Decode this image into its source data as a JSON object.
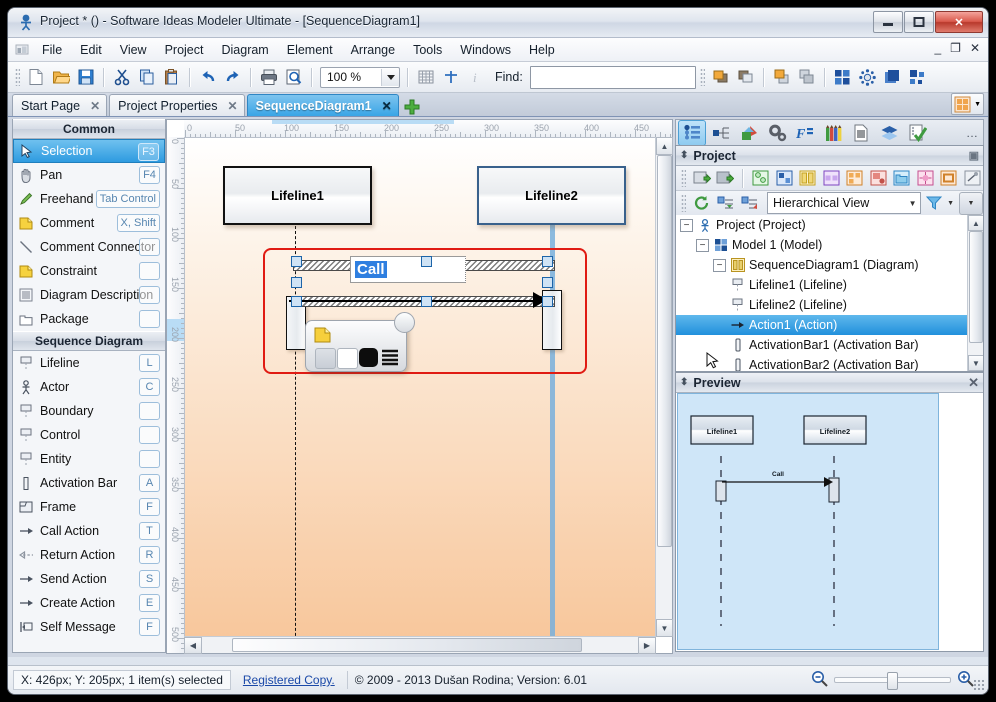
{
  "window": {
    "title": "Project *  ()  - Software Ideas Modeler Ultimate - [SequenceDiagram1]",
    "minimize": "—",
    "maximize": "▭",
    "close": "✕",
    "mdi_minimize": "_",
    "mdi_restore": "❐",
    "mdi_close": "✕"
  },
  "menu": {
    "items": [
      "File",
      "Edit",
      "View",
      "Project",
      "Diagram",
      "Element",
      "Arrange",
      "Tools",
      "Windows",
      "Help"
    ]
  },
  "toolbar": {
    "zoom_value": "100 %",
    "find_label": "Find:",
    "find_value": "",
    "find_placeholder": "",
    "buttons": [
      "new-document",
      "open-file",
      "save-file",
      "cut",
      "copy",
      "paste",
      "undo",
      "redo",
      "print",
      "print-preview",
      "grid",
      "snap",
      "info"
    ],
    "right_buttons": [
      "bring-forward",
      "send-backward",
      "bring-to-front",
      "send-to-back",
      "layout-grid",
      "layout-radial",
      "layout-stack",
      "layout-tree"
    ]
  },
  "tabs": {
    "items": [
      {
        "label": "Start Page",
        "close": "✕",
        "active": false
      },
      {
        "label": "Project Properties",
        "close": "✕",
        "active": false
      },
      {
        "label": "SequenceDiagram1",
        "close": "✕",
        "active": true
      }
    ],
    "add_label": "+"
  },
  "toolbox": {
    "groups": [
      {
        "title": "Common",
        "items": [
          {
            "label": "Selection",
            "key": "F3",
            "icon": "cursor-icon",
            "selected": true
          },
          {
            "label": "Pan",
            "key": "F4",
            "icon": "hand-icon",
            "selected": false
          },
          {
            "label": "Freehand",
            "key": "Tab Control",
            "icon": "pencil-icon",
            "selected": false
          },
          {
            "label": "Comment",
            "key": "X, Shift",
            "icon": "note-icon",
            "selected": false
          },
          {
            "label": "Comment Connector",
            "key": "",
            "icon": "line-icon",
            "selected": false
          },
          {
            "label": "Constraint",
            "key": "",
            "icon": "note-icon",
            "selected": false
          },
          {
            "label": "Diagram Description",
            "key": "",
            "icon": "lines-icon",
            "selected": false
          },
          {
            "label": "Package",
            "key": "",
            "icon": "package-icon",
            "selected": false
          }
        ]
      },
      {
        "title": "Sequence Diagram",
        "items": [
          {
            "label": "Lifeline",
            "key": "L",
            "icon": "lifeline-icon",
            "selected": false
          },
          {
            "label": "Actor",
            "key": "C",
            "icon": "actor-icon",
            "selected": false
          },
          {
            "label": "Boundary",
            "key": "",
            "icon": "lifeline-icon",
            "selected": false
          },
          {
            "label": "Control",
            "key": "",
            "icon": "lifeline-icon",
            "selected": false
          },
          {
            "label": "Entity",
            "key": "",
            "icon": "lifeline-icon",
            "selected": false
          },
          {
            "label": "Activation Bar",
            "key": "A",
            "icon": "activation-bar-icon",
            "selected": false
          },
          {
            "label": "Frame",
            "key": "F",
            "icon": "frame-icon",
            "selected": false
          },
          {
            "label": "Call Action",
            "key": "T",
            "icon": "arrow-right-icon",
            "selected": false
          },
          {
            "label": "Return Action",
            "key": "R",
            "icon": "arrow-left-dashed-icon",
            "selected": false
          },
          {
            "label": "Send Action",
            "key": "S",
            "icon": "arrow-right-icon",
            "selected": false
          },
          {
            "label": "Create Action",
            "key": "E",
            "icon": "arrow-right-icon",
            "selected": false
          },
          {
            "label": "Self Message",
            "key": "F",
            "icon": "self-message-icon",
            "selected": false
          }
        ]
      }
    ]
  },
  "canvas": {
    "ruler_h_ticks": [
      "0",
      "50",
      "100",
      "150",
      "200",
      "250",
      "300",
      "350",
      "400",
      "450"
    ],
    "ruler_v_ticks": [
      "0",
      "50",
      "100",
      "150",
      "200",
      "250",
      "300",
      "350",
      "400",
      "450",
      "500"
    ],
    "diagram": {
      "lifelines": [
        {
          "name": "Lifeline1",
          "selected": false
        },
        {
          "name": "Lifeline2",
          "selected": true
        }
      ],
      "message_label": "Call",
      "edit_text": "Call"
    },
    "float_toolbar": {
      "buttons": [
        "note-icon",
        "swatch-gray",
        "swatch-white",
        "swatch-black",
        "swatch-lines"
      ]
    }
  },
  "right_dock": {
    "strip_buttons": [
      "project-tree-icon",
      "model-structure-icon",
      "shapes-icon",
      "settings-icon",
      "format-icon",
      "styles-icon",
      "documentation-icon",
      "layers-icon",
      "tasks-icon"
    ],
    "strip_overflow": "…",
    "project_panel": {
      "title": "Project",
      "pin": "▣",
      "collapse": "⬍",
      "toolbar_buttons": [
        "add-project",
        "add-model",
        "add-diagram-uml",
        "add-diagram-class",
        "add-diagram-sequence",
        "add-diagram-state",
        "add-diagram-use-case",
        "add-diagram-component",
        "add-diagram-package",
        "add-diagram-deployment",
        "add-diagram-other",
        "link-icon"
      ],
      "toolbar2_buttons": [
        "refresh-icon",
        "expand-all-icon",
        "collapse-all-icon"
      ],
      "view_mode": "Hierarchical View",
      "filter_icon": "filter-icon",
      "tree": [
        {
          "label": "Project (Project)",
          "depth": 0,
          "expander": "−",
          "icon": "project-icon",
          "selected": false
        },
        {
          "label": "Model 1 (Model)",
          "depth": 1,
          "expander": "−",
          "icon": "model-icon",
          "selected": false
        },
        {
          "label": "SequenceDiagram1 (Diagram)",
          "depth": 2,
          "expander": "−",
          "icon": "diagram-icon",
          "selected": false
        },
        {
          "label": "Lifeline1 (Lifeline)",
          "depth": 3,
          "expander": "",
          "icon": "lifeline-icon",
          "selected": false
        },
        {
          "label": "Lifeline2 (Lifeline)",
          "depth": 3,
          "expander": "",
          "icon": "lifeline-icon",
          "selected": false
        },
        {
          "label": "Action1 (Action)",
          "depth": 3,
          "expander": "",
          "icon": "action-icon",
          "selected": true
        },
        {
          "label": "ActivationBar1 (Activation Bar)",
          "depth": 3,
          "expander": "",
          "icon": "activation-bar-icon",
          "selected": false
        },
        {
          "label": "ActivationBar2 (Activation Bar)",
          "depth": 3,
          "expander": "",
          "icon": "activation-bar-icon",
          "selected": false
        }
      ]
    },
    "preview_panel": {
      "title": "Preview",
      "close": "✕",
      "collapse": "⬍",
      "lifelines": [
        "Lifeline1",
        "Lifeline2"
      ],
      "message_label": "Call"
    }
  },
  "status": {
    "coordinates": "X: 426px; Y: 205px; 1 item(s) selected",
    "registration": "Registered Copy.",
    "copyright": "© 2009 - 2013 Dušan Rodina; Version: 6.01",
    "zoom_out": "zoom-out-icon",
    "zoom_in": "zoom-in-icon"
  },
  "colors": {
    "accent": "#2190dc",
    "selection_red": "#e01b13",
    "canvas_top": "#ffffff",
    "canvas_bottom": "#f8c79c",
    "preview_bg": "#cfe6f8"
  }
}
